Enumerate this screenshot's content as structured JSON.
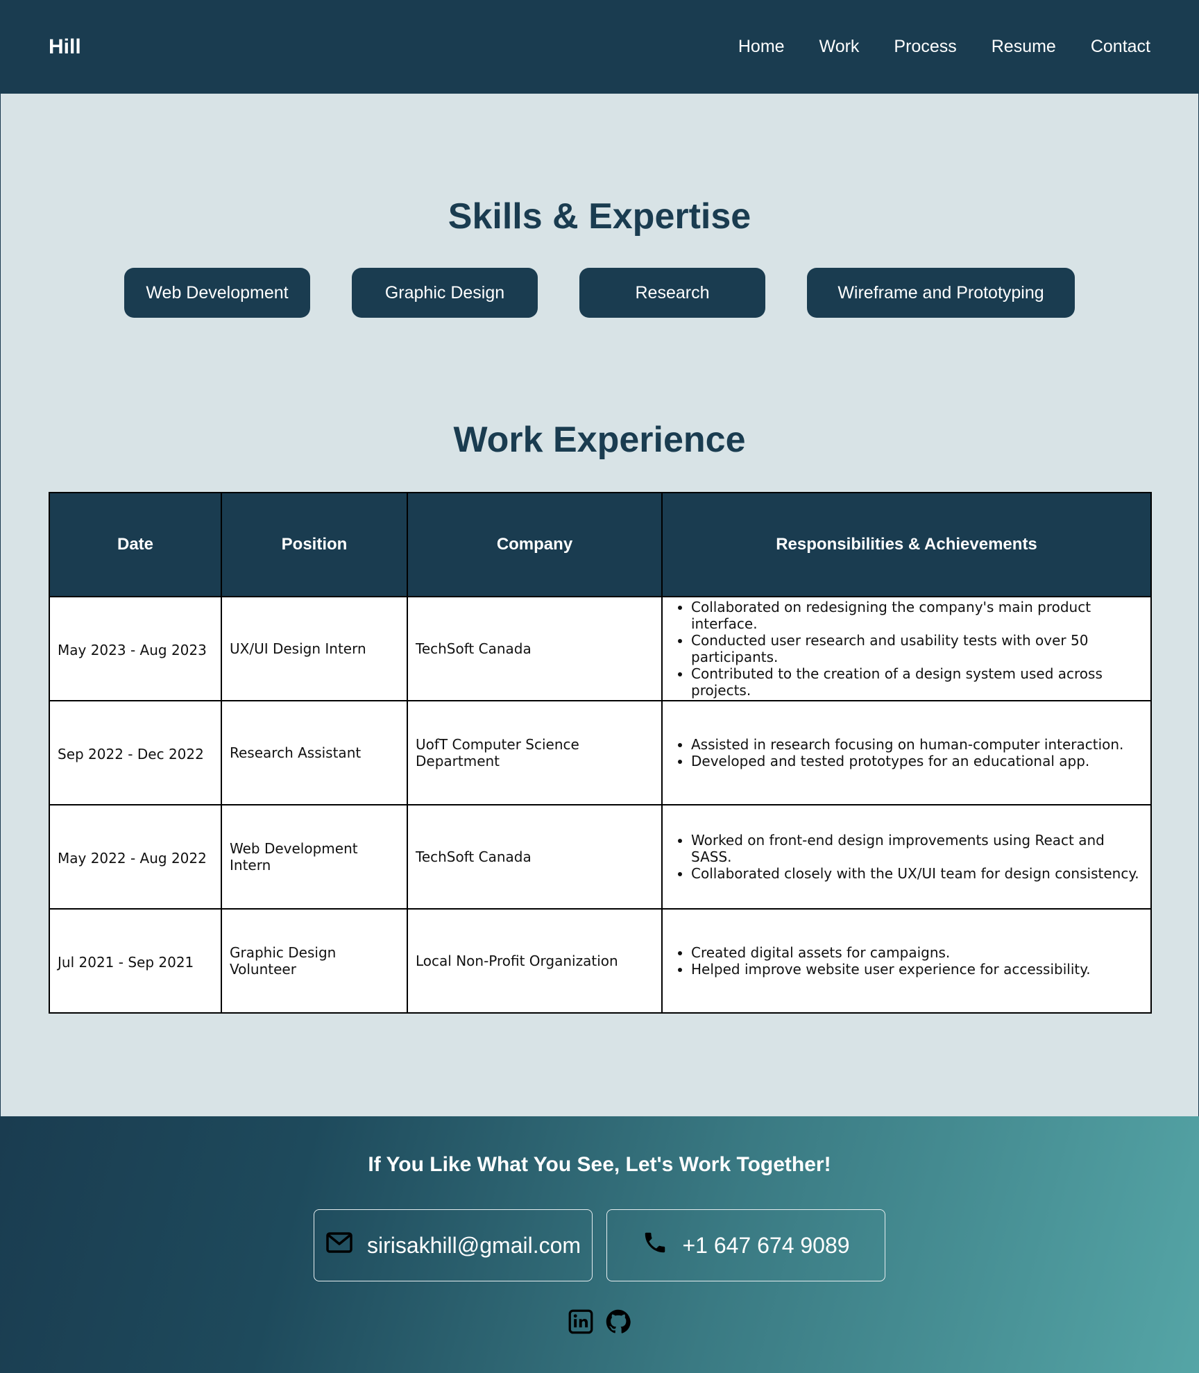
{
  "header": {
    "brand": "Hill",
    "nav": [
      "Home",
      "Work",
      "Process",
      "Resume",
      "Contact"
    ]
  },
  "skills": {
    "title": "Skills & Expertise",
    "items": [
      "Web Development",
      "Graphic Design",
      "Research",
      "Wireframe and Prototyping"
    ]
  },
  "experience": {
    "title": "Work Experience",
    "columns": [
      "Date",
      "Position",
      "Company",
      "Responsibilities & Achievements"
    ],
    "rows": [
      {
        "date": "May 2023 - Aug 2023",
        "position": "UX/UI Design Intern",
        "company": "TechSoft Canada",
        "items": [
          "Collaborated on redesigning the company's main product interface.",
          "Conducted user research and usability tests with over 50 participants.",
          "Contributed to the creation of a design system used across projects."
        ]
      },
      {
        "date": "Sep 2022 - Dec 2022",
        "position": "Research Assistant",
        "company": "UofT Computer Science Department",
        "items": [
          "Assisted in research focusing on human-computer interaction.",
          "Developed and tested prototypes for an educational app."
        ]
      },
      {
        "date": "May 2022 - Aug 2022",
        "position": "Web Development Intern",
        "company": "TechSoft Canada",
        "items": [
          "Worked on front-end design improvements using React and SASS.",
          "Collaborated closely with the UX/UI team for design consistency."
        ]
      },
      {
        "date": "Jul 2021 - Sep 2021",
        "position": "Graphic Design Volunteer",
        "company": "Local Non-Profit Organization",
        "items": [
          "Created digital assets for campaigns.",
          "Helped improve website user experience for accessibility."
        ]
      }
    ]
  },
  "footer": {
    "title": "If You Like What You See, Let's Work Together!",
    "email": "sirisakhill@gmail.com",
    "phone": "+1 647 674 9089",
    "email_icon": "mail-icon",
    "phone_icon": "phone-icon",
    "socials": [
      "linkedin-icon",
      "github-icon"
    ]
  },
  "colors": {
    "primary": "#1a3c50",
    "background": "#d8e3e6",
    "footer_gradient_end": "#55a5a6"
  }
}
